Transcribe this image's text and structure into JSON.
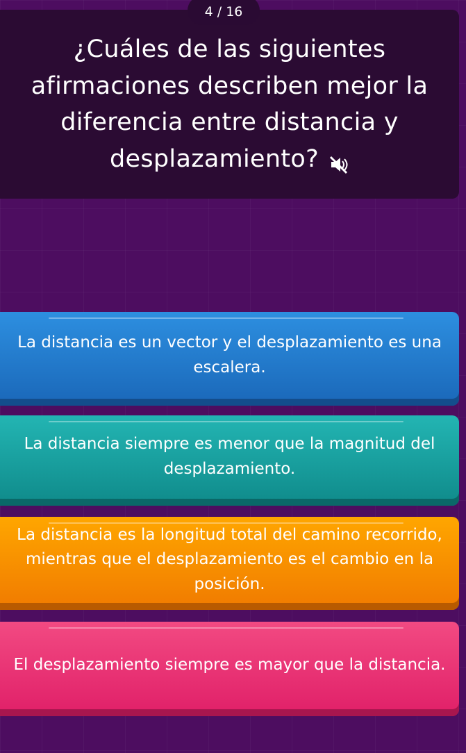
{
  "progress": {
    "current_label": "4 / 16"
  },
  "question": {
    "text": "¿Cuáles de las siguientes afirmaciones describen mejor la diferencia entre distancia y desplazamiento?",
    "audio_icon": "speaker-mute-icon"
  },
  "answers": [
    {
      "label": "La distancia es un vector y el desplazamiento es una escalera.",
      "color": "#2278cc"
    },
    {
      "label": "La distancia siempre es menor que la magnitud del desplazamiento.",
      "color": "#1aa3a2"
    },
    {
      "label": "La distancia es la longitud total del camino recorrido, mientras que el desplazamiento es el cambio en la posición.",
      "color": "#f89200"
    },
    {
      "label": "El desplazamiento siempre es mayor que la distancia.",
      "color": "#ea3575"
    }
  ],
  "colors": {
    "background": "#4d0d60",
    "panel": "#2b0b33",
    "text": "#ffffff"
  }
}
